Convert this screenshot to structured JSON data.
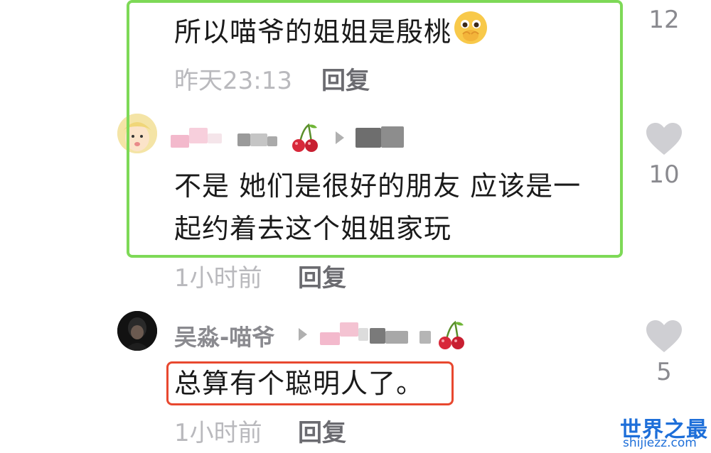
{
  "comments": [
    {
      "text": "所以喵爷的姐姐是殷桃",
      "emoji": "embarrassed-face-emoji",
      "time": "昨天23:13",
      "reply_label": "回复",
      "likes": "12"
    },
    {
      "text_line1": "不是 她们是很好的朋友 应该是一",
      "text_line2": "起约着去这个姐姐家玩",
      "time": "1小时前",
      "reply_label": "回复",
      "likes": "10"
    },
    {
      "username": "吴淼-喵爷",
      "text": "总算有个聪明人了。",
      "time": "1小时前",
      "reply_label": "回复",
      "likes": "5"
    }
  ],
  "watermark": {
    "title": "世界之最",
    "url": "shijiezz.com"
  },
  "colors": {
    "highlight_green": "#7ed957",
    "highlight_red": "#e8482f",
    "heart": "#cfcfd3",
    "watermark_blue": "#1e6fd9"
  }
}
